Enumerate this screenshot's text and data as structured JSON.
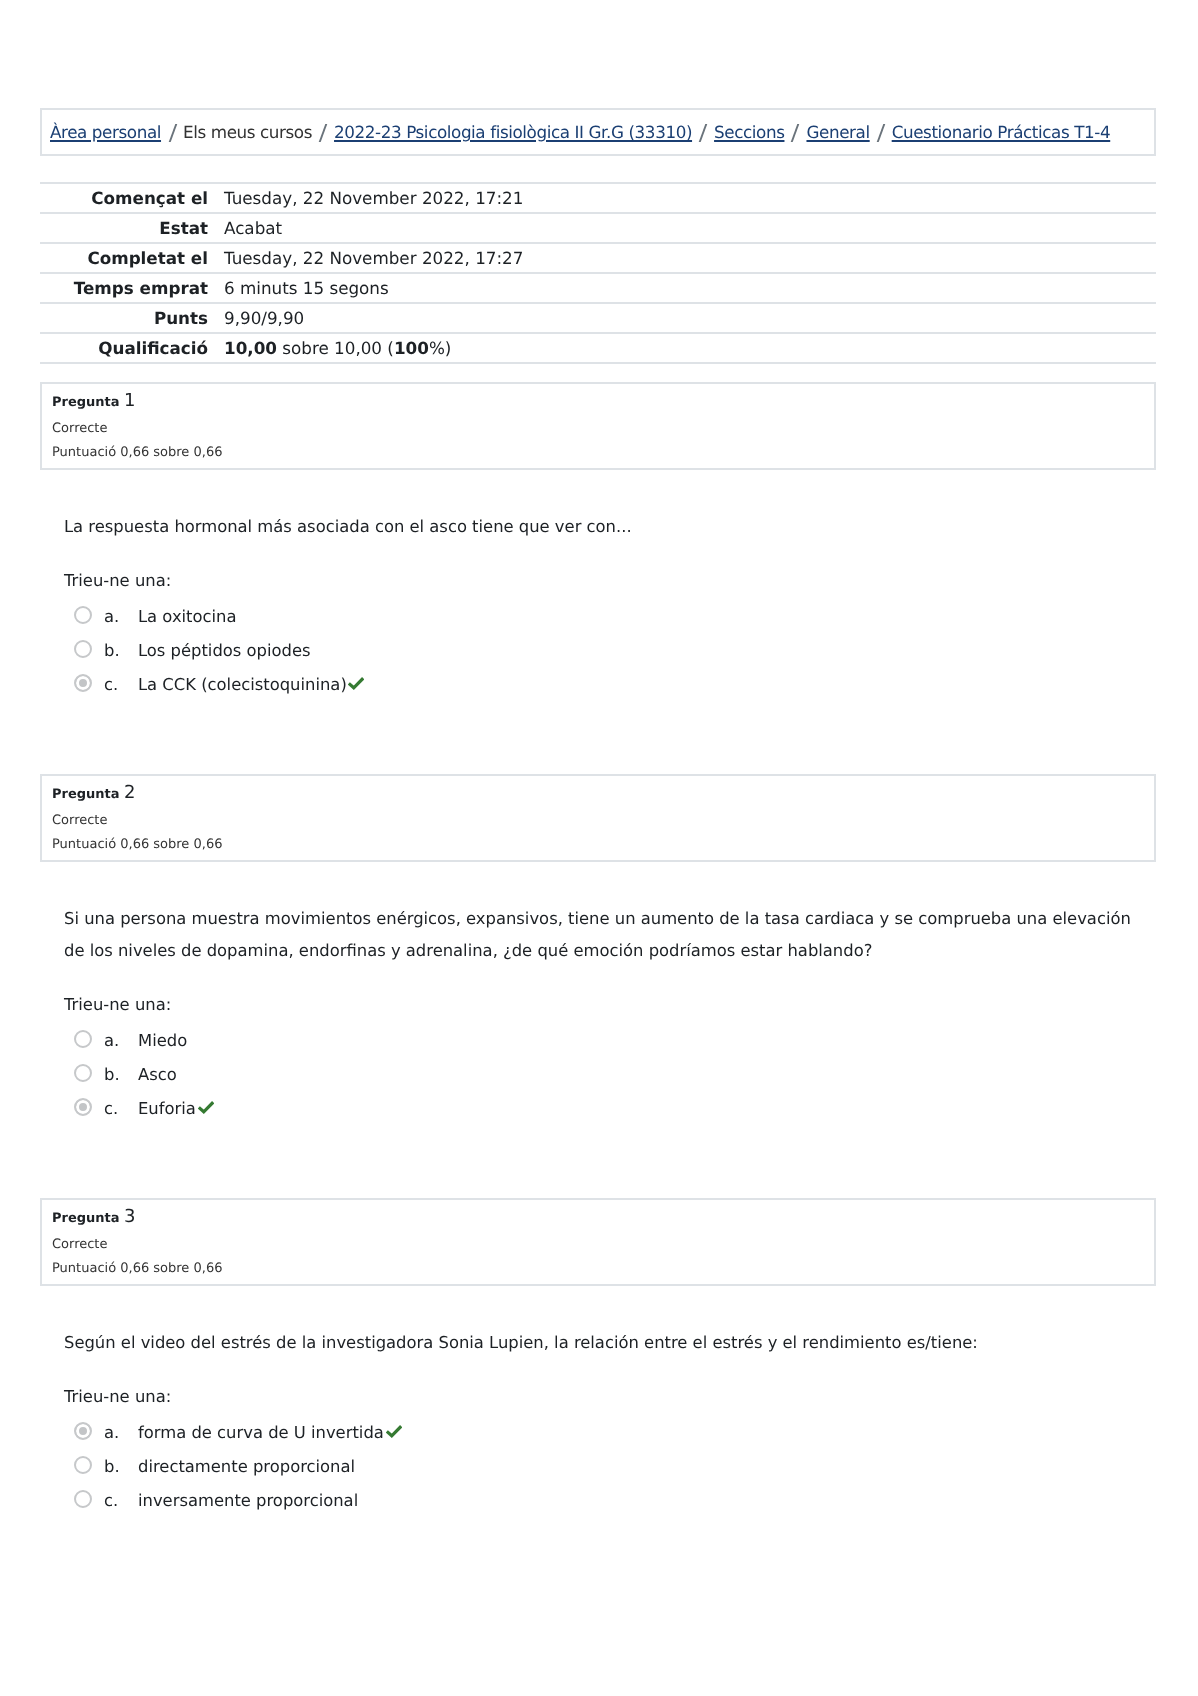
{
  "breadcrumb": [
    {
      "label": "Àrea personal",
      "kind": "link"
    },
    {
      "label": "Els meus cursos",
      "kind": "text"
    },
    {
      "label": "2022-23 Psicologia fisiològica II Gr.G (33310)",
      "kind": "link"
    },
    {
      "label": "Seccions",
      "kind": "link"
    },
    {
      "label": "General",
      "kind": "link"
    },
    {
      "label": "Cuestionario Prácticas T1-4",
      "kind": "link"
    }
  ],
  "summary": [
    {
      "label": "Començat el",
      "value": "Tuesday, 22 November 2022, 17:21"
    },
    {
      "label": "Estat",
      "value": "Acabat"
    },
    {
      "label": "Completat el",
      "value": "Tuesday, 22 November 2022, 17:27"
    },
    {
      "label": "Temps emprat",
      "value": "6 minuts 15 segons"
    },
    {
      "label": "Punts",
      "value": "9,90/9,90"
    },
    {
      "label": "Qualificació",
      "value": "**10,00** sobre 10,00 (**100**%)"
    }
  ],
  "questions": [
    {
      "heading": "Pregunta",
      "number": "1",
      "state": "Correcte",
      "grade": "Puntuació 0,66 sobre 0,66",
      "text": "La respuesta hormonal más asociada con el asco tiene que ver con...",
      "prompt": "Trieu-ne una:",
      "options": [
        {
          "letter": "a.",
          "label": "La oxitocina",
          "selected": false,
          "correct": false
        },
        {
          "letter": "b.",
          "label": "Los péptidos opiodes",
          "selected": false,
          "correct": false
        },
        {
          "letter": "c.",
          "label": "La CCK (colecistoquinina)",
          "selected": true,
          "correct": true
        }
      ]
    },
    {
      "heading": "Pregunta",
      "number": "2",
      "state": "Correcte",
      "grade": "Puntuació 0,66 sobre 0,66",
      "text": "Si una persona muestra movimientos enérgicos, expansivos, tiene un aumento de la tasa cardiaca y se comprueba una elevación de los niveles de dopamina, endorfinas y adrenalina, ¿de qué emoción podríamos estar hablando?",
      "prompt": "Trieu-ne una:",
      "options": [
        {
          "letter": "a.",
          "label": "Miedo",
          "selected": false,
          "correct": false
        },
        {
          "letter": "b.",
          "label": "Asco",
          "selected": false,
          "correct": false
        },
        {
          "letter": "c.",
          "label": "Euforia",
          "selected": true,
          "correct": true
        }
      ]
    },
    {
      "heading": "Pregunta",
      "number": "3",
      "state": "Correcte",
      "grade": "Puntuació 0,66 sobre 0,66",
      "text": "Según el video del estrés de la investigadora Sonia Lupien, la relación entre el estrés y el rendimiento es/tiene:",
      "prompt": "Trieu-ne una:",
      "options": [
        {
          "letter": "a.",
          "label": "forma de curva de U invertida",
          "selected": true,
          "correct": true
        },
        {
          "letter": "b.",
          "label": "directamente proporcional",
          "selected": false,
          "correct": false
        },
        {
          "letter": "c.",
          "label": "inversamente proporcional",
          "selected": false,
          "correct": false
        }
      ]
    }
  ]
}
